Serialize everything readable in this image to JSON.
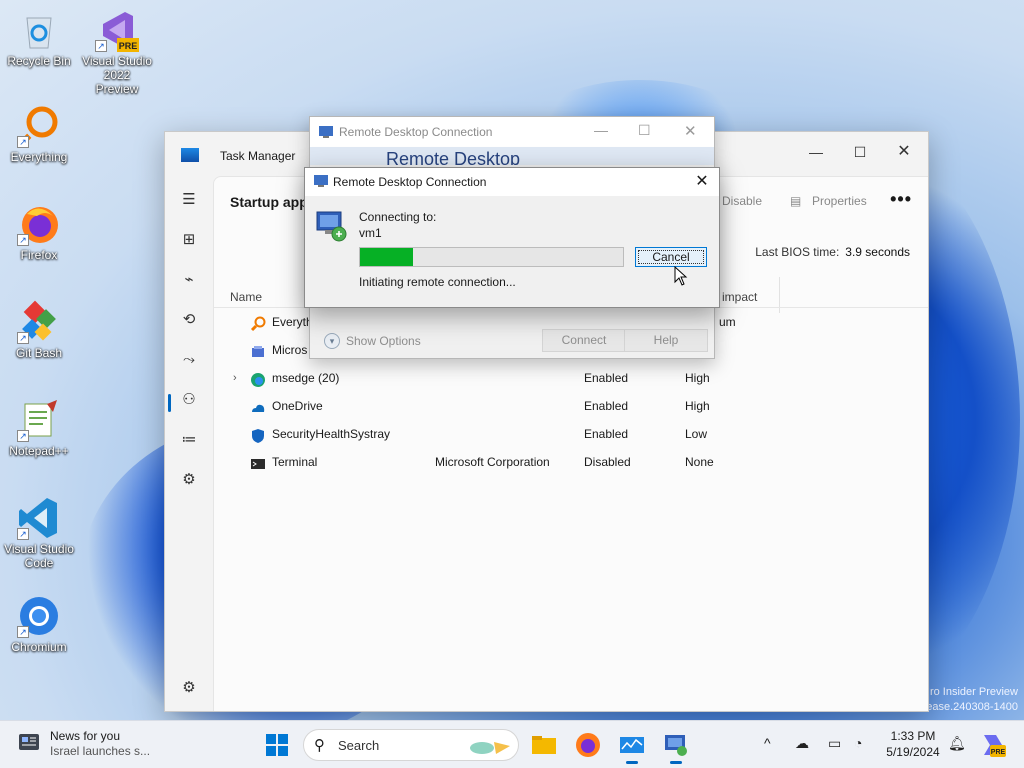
{
  "desktop": {
    "icons": [
      {
        "label": "Recycle Bin"
      },
      {
        "label": "Visual Studio 2022 Preview"
      },
      {
        "label": "Everything"
      },
      {
        "label": "Firefox"
      },
      {
        "label": "Git Bash"
      },
      {
        "label": "Notepad++"
      },
      {
        "label": "Visual Studio Code"
      },
      {
        "label": "Chromium"
      }
    ],
    "watermark": {
      "line1": "ro Insider Preview",
      "line2": "ease.240308-1400"
    }
  },
  "task_manager": {
    "title": "Task Manager",
    "page_heading": "Startup app",
    "toolbar": {
      "disable": "Disable",
      "properties": "Properties",
      "more": "•••"
    },
    "bios_label": "Last BIOS time:",
    "bios_value": "3.9 seconds",
    "columns": {
      "name": "Name",
      "impact": "p impact"
    },
    "rows": [
      {
        "name": "Everyth",
        "publisher": "",
        "status": "",
        "impact": "um"
      },
      {
        "name": "Micros",
        "publisher": "",
        "status": "",
        "impact": ""
      },
      {
        "name": "msedge (20)",
        "publisher": "",
        "status": "Enabled",
        "impact": "High"
      },
      {
        "name": "OneDrive",
        "publisher": "",
        "status": "Enabled",
        "impact": "High"
      },
      {
        "name": "SecurityHealthSystray",
        "publisher": "",
        "status": "Enabled",
        "impact": "Low"
      },
      {
        "name": "Terminal",
        "publisher": "Microsoft Corporation",
        "status": "Disabled",
        "impact": "None"
      }
    ]
  },
  "rdc_back": {
    "title": "Remote Desktop Connection",
    "banner": "Remote Desktop",
    "show_options": "Show Options",
    "connect": "Connect",
    "help": "Help"
  },
  "rdc_dialog": {
    "title": "Remote Desktop Connection",
    "connecting_to": "Connecting to:",
    "host": "vm1",
    "progress_fraction": 0.2,
    "cancel": "Cancel",
    "status": "Initiating remote connection..."
  },
  "taskbar": {
    "news_title": "News for you",
    "news_sub": "Israel launches s...",
    "search_label": "Search",
    "time": "1:33 PM",
    "date": "5/19/2024"
  },
  "colors": {
    "accent": "#0067c0",
    "progress": "#06b025"
  }
}
